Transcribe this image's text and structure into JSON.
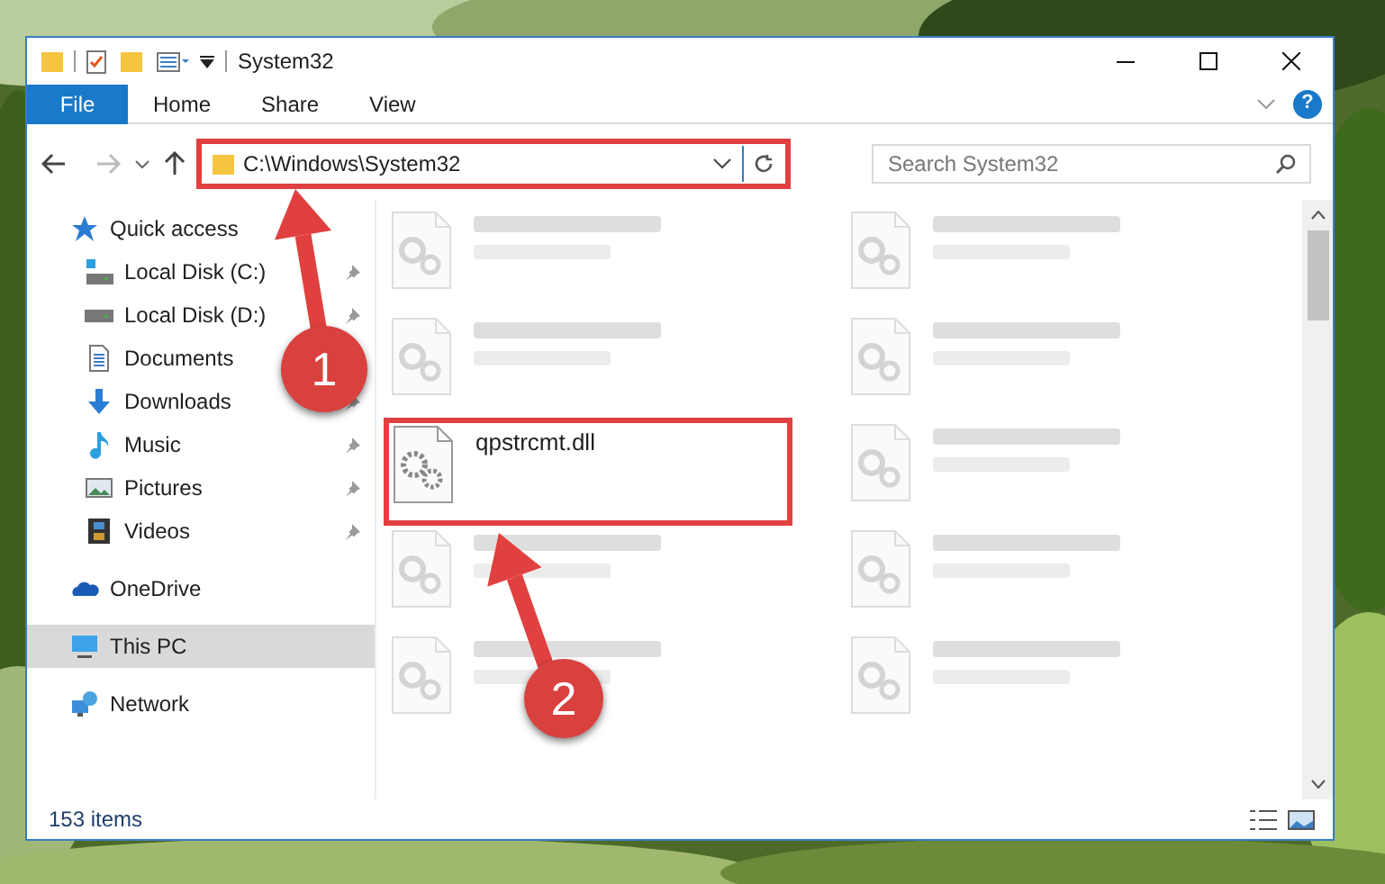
{
  "window": {
    "title": "System32"
  },
  "ribbon": {
    "tabs": [
      {
        "label": "File",
        "kind": "file"
      },
      {
        "label": "Home",
        "kind": "tab"
      },
      {
        "label": "Share",
        "kind": "tab"
      },
      {
        "label": "View",
        "kind": "tab"
      }
    ],
    "help": "?"
  },
  "address_bar": {
    "value": "C:\\Windows\\System32",
    "highlighted": true
  },
  "search": {
    "placeholder": "Search System32"
  },
  "navigation": [
    {
      "label": "Quick access",
      "kind": "star",
      "selected": false,
      "children": [
        {
          "label": "Local Disk (C:)",
          "kind": "disk-c",
          "pinned": true
        },
        {
          "label": "Local Disk (D:)",
          "kind": "disk",
          "pinned": true
        },
        {
          "label": "Documents",
          "kind": "documents",
          "pinned": false
        },
        {
          "label": "Downloads",
          "kind": "downloads",
          "pinned": true
        },
        {
          "label": "Music",
          "kind": "music",
          "pinned": true
        },
        {
          "label": "Pictures",
          "kind": "pictures",
          "pinned": true
        },
        {
          "label": "Videos",
          "kind": "videos",
          "pinned": true
        }
      ]
    },
    {
      "label": "OneDrive",
      "kind": "cloud",
      "selected": false
    },
    {
      "label": "This PC",
      "kind": "pc",
      "selected": true
    },
    {
      "label": "Network",
      "kind": "network",
      "selected": false
    }
  ],
  "files": [
    {
      "kind": "blurred"
    },
    {
      "kind": "blurred"
    },
    {
      "kind": "blurred"
    },
    {
      "kind": "blurred"
    },
    {
      "kind": "file",
      "name": "qpstrcmt.dll",
      "highlighted": true
    },
    {
      "kind": "blurred"
    },
    {
      "kind": "blurred"
    },
    {
      "kind": "blurred"
    },
    {
      "kind": "blurred"
    },
    {
      "kind": "blurred"
    }
  ],
  "status_bar": {
    "count": "153 items"
  },
  "annotations": [
    {
      "kind": "arrow"
    },
    {
      "kind": "arrow"
    },
    {
      "kind": "callout",
      "label": "1"
    },
    {
      "kind": "callout",
      "label": "2"
    }
  ]
}
